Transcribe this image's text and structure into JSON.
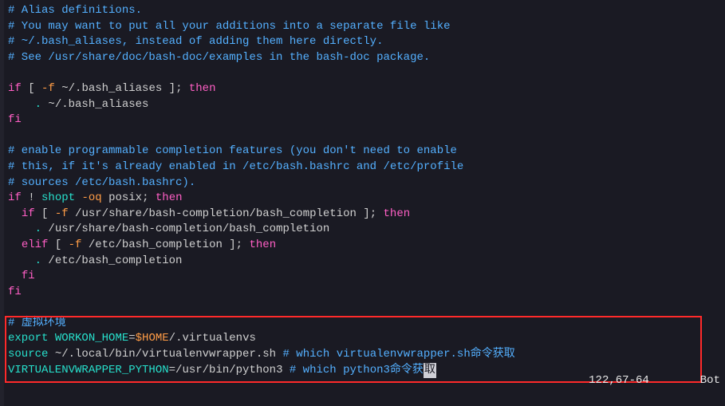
{
  "status": {
    "position": "122,67-64",
    "scroll": "Bot"
  },
  "cursor_char": "取",
  "lines": [
    {
      "segs": [
        {
          "t": "# Alias definitions.",
          "c": "comment"
        }
      ]
    },
    {
      "segs": [
        {
          "t": "# You may want to put all your additions into a separate file like",
          "c": "comment"
        }
      ]
    },
    {
      "segs": [
        {
          "t": "# ~/.bash_aliases, instead of adding them here directly.",
          "c": "comment"
        }
      ]
    },
    {
      "segs": [
        {
          "t": "# See /usr/share/doc/bash-doc/examples in the bash-doc package.",
          "c": "comment"
        }
      ]
    },
    {
      "segs": [
        {
          "t": "",
          "c": "plain"
        }
      ]
    },
    {
      "segs": [
        {
          "t": "if",
          "c": "key"
        },
        {
          "t": " [ ",
          "c": "plain"
        },
        {
          "t": "-f",
          "c": "opt"
        },
        {
          "t": " ~/.bash_aliases ]; ",
          "c": "plain"
        },
        {
          "t": "then",
          "c": "key"
        }
      ]
    },
    {
      "segs": [
        {
          "t": "    ",
          "c": "plain"
        },
        {
          "t": ".",
          "c": "cmd"
        },
        {
          "t": " ~/.bash_aliases",
          "c": "plain"
        }
      ]
    },
    {
      "segs": [
        {
          "t": "fi",
          "c": "key"
        }
      ]
    },
    {
      "segs": [
        {
          "t": "",
          "c": "plain"
        }
      ]
    },
    {
      "segs": [
        {
          "t": "# enable programmable completion features (you don't need to enable",
          "c": "comment"
        }
      ]
    },
    {
      "segs": [
        {
          "t": "# this, if it's already enabled in /etc/bash.bashrc and /etc/profile",
          "c": "comment"
        }
      ]
    },
    {
      "segs": [
        {
          "t": "# sources /etc/bash.bashrc).",
          "c": "comment"
        }
      ]
    },
    {
      "segs": [
        {
          "t": "if",
          "c": "key"
        },
        {
          "t": " ! ",
          "c": "plain"
        },
        {
          "t": "shopt",
          "c": "cmd"
        },
        {
          "t": " ",
          "c": "plain"
        },
        {
          "t": "-oq",
          "c": "opt"
        },
        {
          "t": " posix; ",
          "c": "plain"
        },
        {
          "t": "then",
          "c": "key"
        }
      ]
    },
    {
      "segs": [
        {
          "t": "  ",
          "c": "plain"
        },
        {
          "t": "if",
          "c": "key"
        },
        {
          "t": " [ ",
          "c": "plain"
        },
        {
          "t": "-f",
          "c": "opt"
        },
        {
          "t": " /usr/share/bash-completion/bash_completion ]; ",
          "c": "plain"
        },
        {
          "t": "then",
          "c": "key"
        }
      ]
    },
    {
      "segs": [
        {
          "t": "    ",
          "c": "plain"
        },
        {
          "t": ".",
          "c": "cmd"
        },
        {
          "t": " /usr/share/bash-completion/bash_completion",
          "c": "plain"
        }
      ]
    },
    {
      "segs": [
        {
          "t": "  ",
          "c": "plain"
        },
        {
          "t": "elif",
          "c": "key"
        },
        {
          "t": " [ ",
          "c": "plain"
        },
        {
          "t": "-f",
          "c": "opt"
        },
        {
          "t": " /etc/bash_completion ]; ",
          "c": "plain"
        },
        {
          "t": "then",
          "c": "key"
        }
      ]
    },
    {
      "segs": [
        {
          "t": "    ",
          "c": "plain"
        },
        {
          "t": ".",
          "c": "cmd"
        },
        {
          "t": " /etc/bash_completion",
          "c": "plain"
        }
      ]
    },
    {
      "segs": [
        {
          "t": "  ",
          "c": "plain"
        },
        {
          "t": "fi",
          "c": "key"
        }
      ]
    },
    {
      "segs": [
        {
          "t": "fi",
          "c": "key"
        }
      ]
    },
    {
      "segs": [
        {
          "t": "",
          "c": "plain"
        }
      ]
    },
    {
      "segs": [
        {
          "t": "# 虚拟环境",
          "c": "comment"
        }
      ]
    },
    {
      "segs": [
        {
          "t": "export",
          "c": "cmd"
        },
        {
          "t": " ",
          "c": "plain"
        },
        {
          "t": "WORKON_HOME",
          "c": "var"
        },
        {
          "t": "=",
          "c": "assign"
        },
        {
          "t": "$HOME",
          "c": "val"
        },
        {
          "t": "/.virtualenvs",
          "c": "plain"
        }
      ]
    },
    {
      "segs": [
        {
          "t": "source",
          "c": "cmd"
        },
        {
          "t": " ~/.local/bin/virtualenvwrapper.sh ",
          "c": "plain"
        },
        {
          "t": "# which virtualenvwrapper.sh命令获取",
          "c": "comment"
        }
      ]
    },
    {
      "segs": [
        {
          "t": "VIRTUALENVWRAPPER_PYTHON",
          "c": "var"
        },
        {
          "t": "=",
          "c": "assign"
        },
        {
          "t": "/usr/bin/python3 ",
          "c": "plain"
        },
        {
          "t": "# which python3命令获",
          "c": "comment"
        },
        {
          "t": "CURSOR",
          "c": "cursor"
        }
      ]
    }
  ]
}
